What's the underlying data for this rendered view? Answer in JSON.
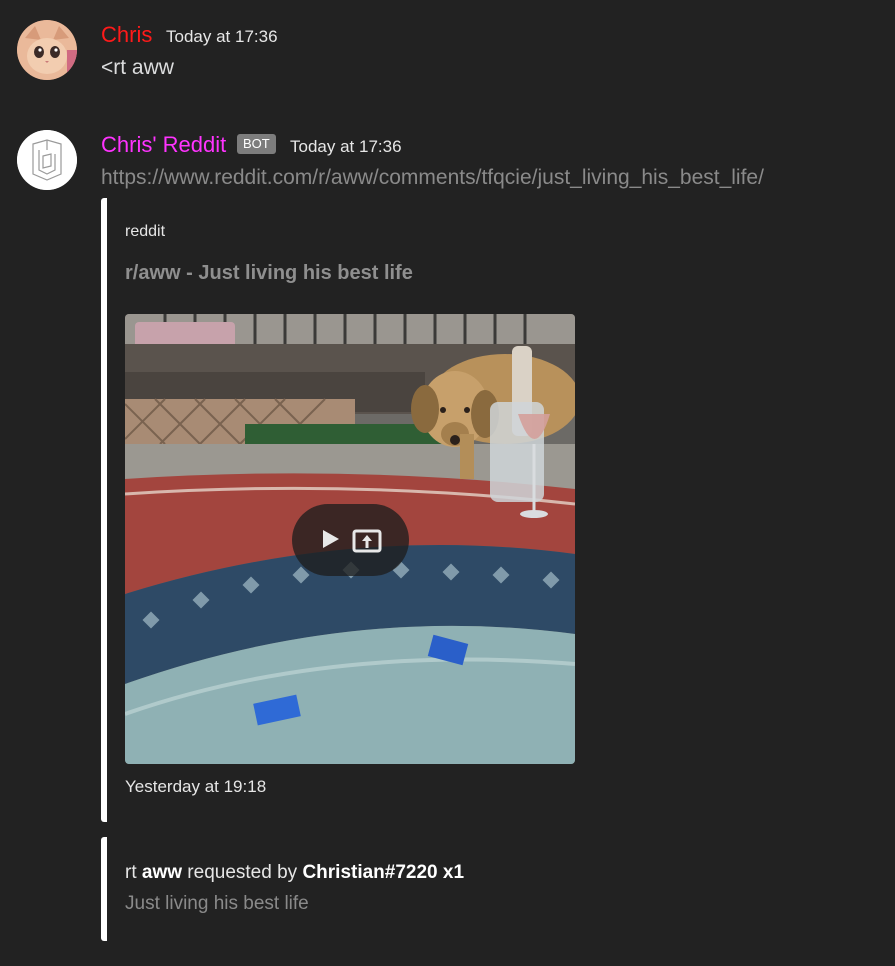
{
  "messages": [
    {
      "author": "Chris",
      "author_color": "#ff1a1a",
      "timestamp": "Today at 17:36",
      "content": "<rt aww",
      "avatar_icon": "cat-avatar"
    },
    {
      "author": "Chris' Reddit",
      "author_color": "#ff33ff",
      "badge": "BOT",
      "timestamp": "Today at 17:36",
      "link": "https://www.reddit.com/r/aww/comments/tfqcie/just_living_his_best_life/",
      "avatar_icon": "bot-logo-avatar",
      "embed": {
        "provider": "reddit",
        "title": "r/aww - Just living his best life",
        "media_icon": "video-thumbnail",
        "play_icon": "play-icon",
        "open_icon": "open-external-icon",
        "footer_timestamp": "Yesterday at 19:18"
      },
      "embed2": {
        "prefix": "rt",
        "subreddit": "aww",
        "requested_by_label": "requested by",
        "user": "Christian#7220",
        "count": "x1",
        "description": "Just living his best life"
      }
    }
  ]
}
